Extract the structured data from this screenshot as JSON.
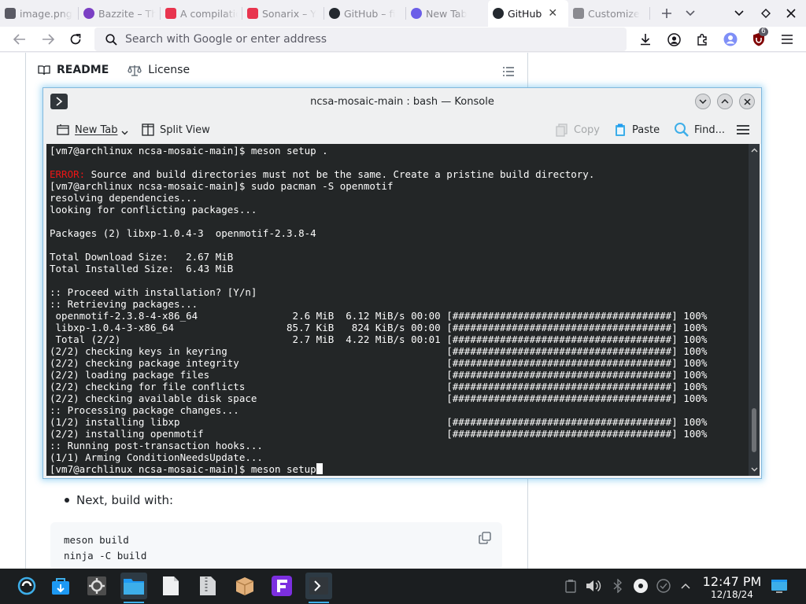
{
  "browser": {
    "tabs": [
      {
        "label": "image.png",
        "icon": "image-icon",
        "color": "#5a5a64"
      },
      {
        "label": "Bazzite – The",
        "icon": "bazzite-icon",
        "color": "#7b3fc4"
      },
      {
        "label": "A compilation",
        "icon": "youtube-icon",
        "color": "#e8344e"
      },
      {
        "label": "Sonarix – Y",
        "icon": "youtube-icon",
        "color": "#e8344e"
      },
      {
        "label": "GitHub – fi",
        "icon": "github-icon",
        "color": "#24292f"
      },
      {
        "label": "New Tab",
        "icon": "firefox-icon",
        "color": "#6b5ee8"
      },
      {
        "label": "GitHub",
        "icon": "github-icon",
        "color": "#24292f",
        "active": true
      },
      {
        "label": "Customize",
        "icon": "puzzle-icon",
        "color": "#5b5b66"
      }
    ],
    "url_placeholder": "Search with Google or enter address",
    "extension_badge": "6"
  },
  "page": {
    "readme_tab": "README",
    "license_tab": "License",
    "bullet_text": "Next, build with:",
    "code_lines": [
      "meson build",
      "ninja -C build"
    ]
  },
  "konsole": {
    "title": "ncsa-mosaic-main : bash — Konsole",
    "toolbar": {
      "new_tab": "New Tab",
      "split_view": "Split View",
      "copy": "Copy",
      "paste": "Paste",
      "find": "Find..."
    },
    "lines": [
      "[vm7@archlinux ncsa-mosaic-main]$ meson setup .",
      "",
      "ERROR: Source and build directories must not be the same. Create a pristine build directory.",
      "[vm7@archlinux ncsa-mosaic-main]$ sudo pacman -S openmotif",
      "resolving dependencies...",
      "looking for conflicting packages...",
      "",
      "Packages (2) libxp-1.0.4-3  openmotif-2.3.8-4",
      "",
      "Total Download Size:   2.67 MiB",
      "Total Installed Size:  6.43 MiB",
      "",
      ":: Proceed with installation? [Y/n]",
      ":: Retrieving packages...",
      " openmotif-2.3.8-4-x86_64                2.6 MiB  6.12 MiB/s 00:00 [#####################################] 100%",
      " libxp-1.0.4-3-x86_64                   85.7 KiB   824 KiB/s 00:00 [#####################################] 100%",
      " Total (2/2)                             2.7 MiB  4.22 MiB/s 00:01 [#####################################] 100%",
      "(2/2) checking keys in keyring                                     [#####################################] 100%",
      "(2/2) checking package integrity                                   [#####################################] 100%",
      "(2/2) loading package files                                        [#####################################] 100%",
      "(2/2) checking for file conflicts                                  [#####################################] 100%",
      "(2/2) checking available disk space                                [#####################################] 100%",
      ":: Processing package changes...",
      "(1/2) installing libxp                                             [#####################################] 100%",
      "(2/2) installing openmotif                                         [#####################################] 100%",
      ":: Running post-transaction hooks...",
      "(1/1) Arming ConditionNeedsUpdate...",
      "[vm7@archlinux ncsa-mosaic-main]$ meson setup"
    ]
  },
  "taskbar": {
    "time": "12:47 PM",
    "date": "12/18/24"
  },
  "colors": {
    "terminal_bg": "#232627",
    "error_red": "#ed1515",
    "accent_blue": "#3daee9"
  }
}
